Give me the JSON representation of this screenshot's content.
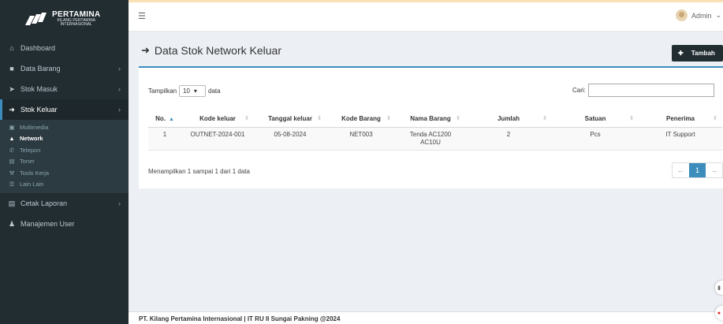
{
  "brand": {
    "title": "PERTAMINA",
    "sub1": "KILANG PERTAMINA",
    "sub2": "INTERNASIONAL"
  },
  "colors": {
    "sidebar_bg": "#222d32",
    "accent": "#3c8dbc",
    "brand_red": "#e2231a",
    "brand_green": "#8dc63f",
    "brand_blue": "#0072bc"
  },
  "sidebar": {
    "items": [
      {
        "label": "Dashboard",
        "icon": "home-icon"
      },
      {
        "label": "Data Barang",
        "icon": "folder-icon",
        "chevron": "›"
      },
      {
        "label": "Stok Masuk",
        "icon": "sign-in-icon",
        "chevron": "›"
      },
      {
        "label": "Stok Keluar",
        "icon": "sign-out-icon",
        "chevron": "›"
      },
      {
        "label": "Cetak Laporan",
        "icon": "print-icon",
        "chevron": "›"
      },
      {
        "label": "Manajemen User",
        "icon": "user-icon"
      }
    ],
    "sub_items": [
      {
        "label": "Multimedia",
        "icon": "camera-icon"
      },
      {
        "label": "Network",
        "icon": "sitemap-icon"
      },
      {
        "label": "Telepon",
        "icon": "phone-icon"
      },
      {
        "label": "Toner",
        "icon": "print-icon"
      },
      {
        "label": "Tools Kerja",
        "icon": "wrench-icon"
      },
      {
        "label": "Lain Lain",
        "icon": "list-icon"
      }
    ]
  },
  "topbar": {
    "user_name": "Admin"
  },
  "page": {
    "title": "Data Stok Network Keluar",
    "add_label": "Tambah"
  },
  "table_controls": {
    "show_prefix": "Tampilkan",
    "show_value": "10",
    "show_suffix": "data",
    "search_label": "Cari:"
  },
  "table": {
    "headers": [
      "No.",
      "Kode keluar",
      "Tanggal keluar",
      "Kode Barang",
      "Nama Barang",
      "Jumlah",
      "Satuan",
      "Penerima"
    ],
    "rows": [
      {
        "no": "1",
        "kode_keluar": "OUTNET-2024-001",
        "tanggal": "05-08-2024",
        "kode_barang": "NET003",
        "nama_barang_1": "Tenda AC1200",
        "nama_barang_2": "AC10U",
        "jumlah": "2",
        "satuan": "Pcs",
        "penerima": "IT Support"
      }
    ]
  },
  "info": "Menampilkan 1 sampai 1 dari 1 data",
  "pager": {
    "prev": "←",
    "current": "1",
    "next": "→"
  },
  "footer": "PT. Kilang Pertamina Internasional | IT RU II Sungai Pakning @2024"
}
